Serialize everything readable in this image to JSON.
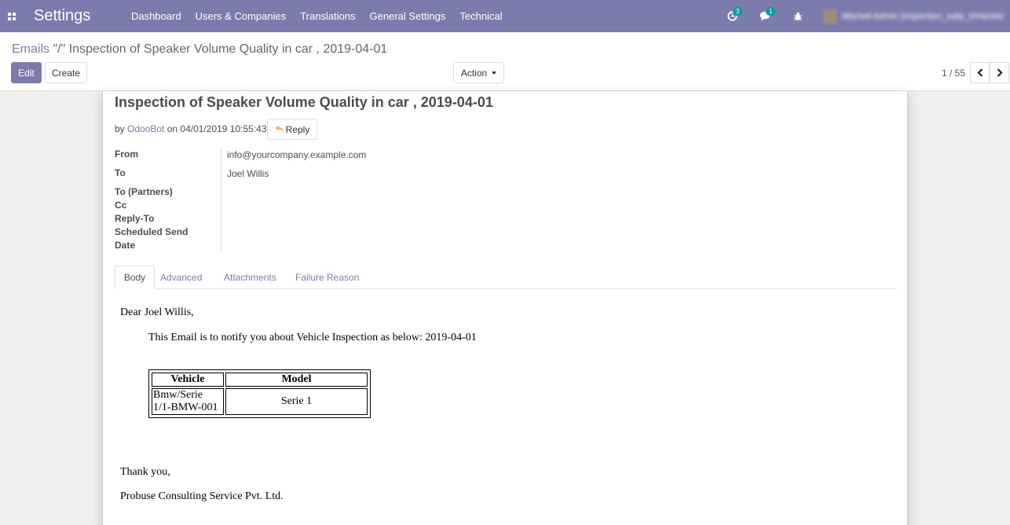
{
  "navbar": {
    "brand": "Settings",
    "menu": [
      "Dashboard",
      "Users & Companies",
      "Translations",
      "General Settings",
      "Technical"
    ],
    "activity_count": "3",
    "messages_count": "1",
    "user_name": "Mitchell Admin (inspection_sally_0/Hanelo)"
  },
  "control": {
    "breadcrumb_link": "Emails",
    "breadcrumb_sep": " \"/\" ",
    "breadcrumb_current": "Inspection of Speaker Volume Quality in car , 2019-04-01",
    "edit_label": "Edit",
    "create_label": "Create",
    "action_label": "Action",
    "pager": "1 / 55"
  },
  "message": {
    "subject": "Inspection of Speaker Volume Quality in car , 2019-04-01",
    "by_prefix": "by ",
    "author": "OdooBot",
    "on_text": " on 04/01/2019 10:55:43",
    "reply_label": "Reply"
  },
  "fields": {
    "from_label": "From",
    "from_value": "info@yourcompany.example.com",
    "to_label": "To",
    "to_value": "Joel Willis",
    "to_partners_label": "To (Partners)",
    "cc_label": "Cc",
    "reply_to_label": "Reply-To",
    "scheduled_label": "Scheduled Send",
    "date_label": "Date"
  },
  "tabs": [
    "Body",
    "Advanced",
    "Attachments",
    "Failure Reason"
  ],
  "body": {
    "greeting": "Dear Joel Willis,",
    "intro": "This Email is to notify you about Vehicle Inspection as below: 2019-04-01",
    "table_headers": [
      "Vehicle",
      "Model"
    ],
    "table_row": [
      "Bmw/Serie 1/1-BMW-001",
      "Serie 1"
    ],
    "thanks": "Thank you,",
    "company": "Probuse Consulting Service Pvt. Ltd."
  },
  "colors": {
    "brand": "#7c7bad",
    "badge": "#00a09d",
    "reply_icon": "#f0ad4e"
  }
}
